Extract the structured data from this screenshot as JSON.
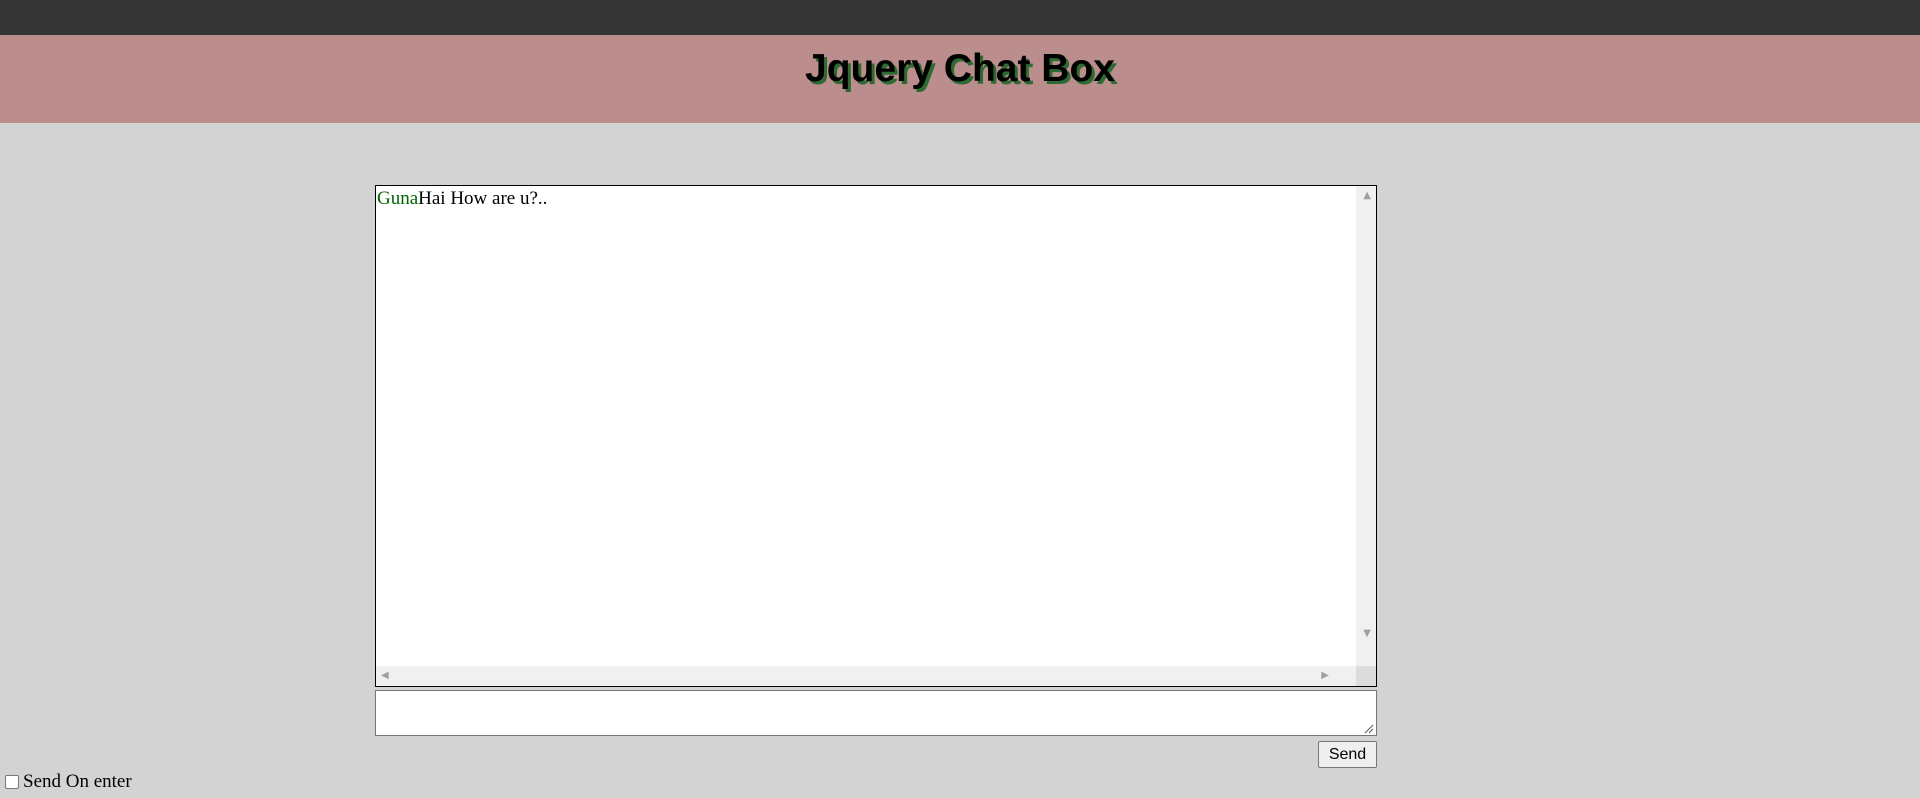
{
  "header": {
    "title": "Jquery Chat Box"
  },
  "chat": {
    "messages": [
      {
        "user": "Guna",
        "text": "Hai How are u?.."
      }
    ]
  },
  "input": {
    "value": "",
    "placeholder": ""
  },
  "send_button": {
    "label": "Send"
  },
  "send_on_enter": {
    "label": "Send On enter",
    "checked": false
  },
  "colors": {
    "top_bar": "#353535",
    "header_background": "#bc8d8d",
    "page_background": "#d3d3d3",
    "title_shadow": "#2e6b32",
    "username": "#006400"
  },
  "icons": {
    "scroll_up": "triangle-up",
    "scroll_down": "triangle-down",
    "scroll_left": "triangle-left",
    "scroll_right": "triangle-right",
    "resize": "resize-grip"
  }
}
